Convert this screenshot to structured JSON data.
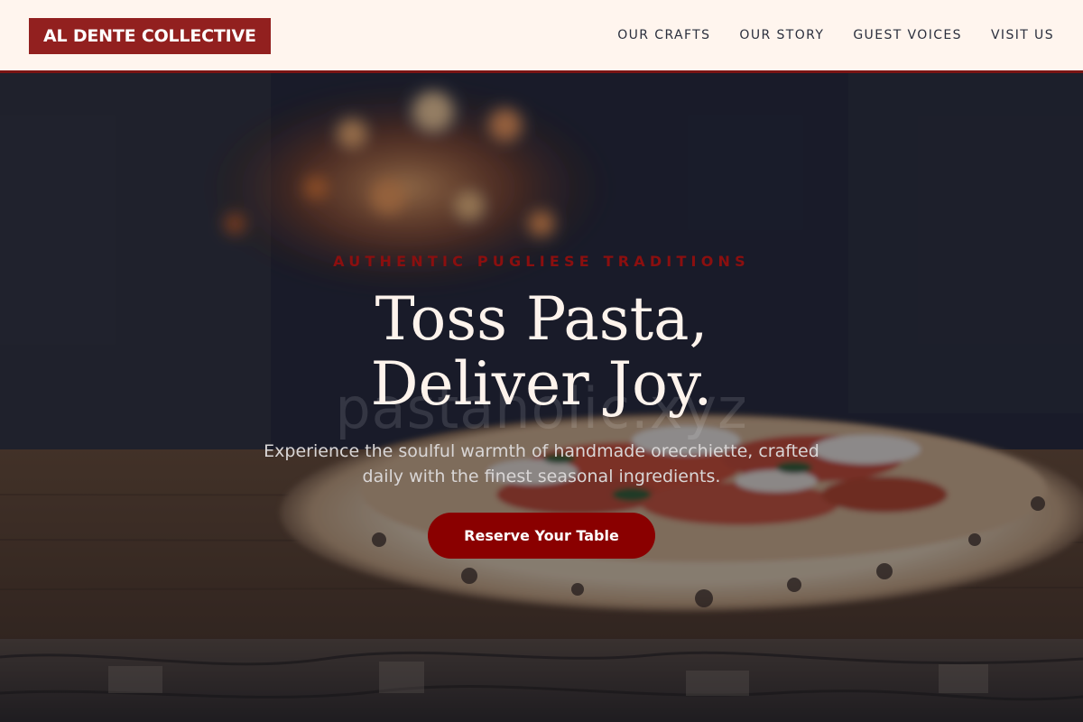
{
  "header": {
    "logo": "AL DENTE COLLECTIVE",
    "nav": [
      {
        "label": "OUR CRAFTS"
      },
      {
        "label": "OUR STORY"
      },
      {
        "label": "GUEST VOICES"
      },
      {
        "label": "VISIT US"
      }
    ]
  },
  "hero": {
    "eyebrow": "AUTHENTIC PUGLIESE TRADITIONS",
    "headline_line1": "Toss Pasta,",
    "headline_line2": "Deliver Joy.",
    "subtext": "Experience the soulful warmth of handmade orecchiette, crafted daily with the finest seasonal ingredients.",
    "cta_label": "Reserve Your Table",
    "watermark": "pastaholic.xyz"
  },
  "colors": {
    "brand": "#92201f",
    "cta": "#8a0000",
    "eyebrow": "#8b0f0f",
    "header_bg": "#fff5ee"
  }
}
